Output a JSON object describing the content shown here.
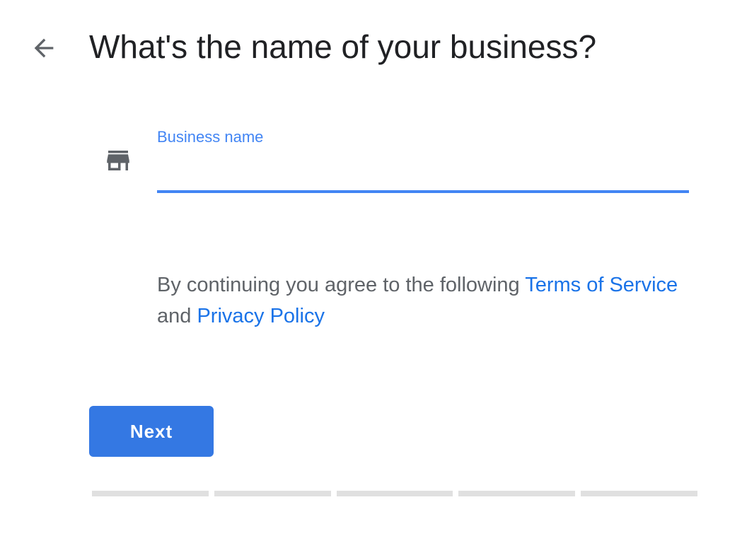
{
  "header": {
    "back_icon": "arrow-back-icon",
    "title": "What's the name of your business?"
  },
  "business_field": {
    "icon": "storefront-icon",
    "label": "Business name",
    "value": "",
    "placeholder": ""
  },
  "terms": {
    "prefix": "By continuing you agree to the following ",
    "tos_link": "Terms of Service",
    "conjunction": " and ",
    "privacy_link": "Privacy Policy"
  },
  "next_button": {
    "label": "Next"
  },
  "progress": {
    "total_steps": 5,
    "completed_steps": 0
  },
  "colors": {
    "accent": "#4285f4",
    "link": "#1a73e8",
    "button": "#3478e3",
    "title_text": "#202124",
    "body_text": "#5f6368",
    "icon": "#5f6368",
    "progress_track": "#e0e0e0"
  }
}
